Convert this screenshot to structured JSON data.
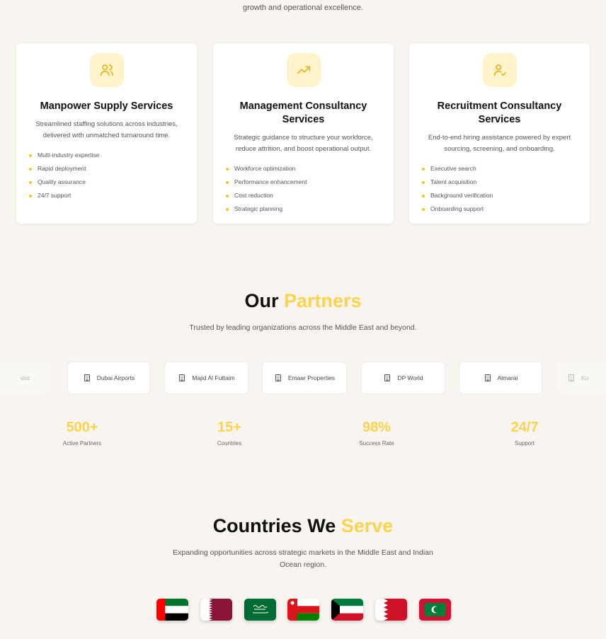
{
  "intro": {
    "line2": "growth and operational excellence."
  },
  "services": [
    {
      "icon": "users-icon",
      "title": "Manpower Supply Services",
      "description": "Streamlined staffing solutions across industries, delivered with unmatched turnaround time.",
      "features": [
        "Multi-industry expertise",
        "Rapid deployment",
        "Quality assurance",
        "24/7 support"
      ]
    },
    {
      "icon": "trending-up-icon",
      "title": "Management Consultancy Services",
      "description": "Strategic guidance to structure your workforce, reduce attrition, and boost operational output.",
      "features": [
        "Workforce optimization",
        "Performance enhancement",
        "Cost reduction",
        "Strategic planning"
      ]
    },
    {
      "icon": "user-check-icon",
      "title": "Recruitment Consultancy Services",
      "description": "End-to-end hiring assistance powered by expert sourcing, screening, and onboarding.",
      "features": [
        "Executive search",
        "Talent acquisition",
        "Background verification",
        "Onboarding support"
      ]
    }
  ],
  "partners_section": {
    "title_main": "Our",
    "title_accent": "Partners",
    "subtitle": "Trusted by leading organizations across the Middle East and beyond.",
    "partners": [
      "Dubai Airports",
      "Majid Al Futtaim",
      "Emaar Properties",
      "DP World",
      "Almarai"
    ],
    "partner_icon": "building-icon",
    "stats": [
      {
        "value": "500+",
        "label": "Active Partners"
      },
      {
        "value": "15+",
        "label": "Countries"
      },
      {
        "value": "98%",
        "label": "Success Rate"
      },
      {
        "value": "24/7",
        "label": "Support"
      }
    ]
  },
  "countries_section": {
    "title_main": "Countries We",
    "title_accent": "Serve",
    "subtitle_line1": "Expanding opportunities across strategic markets in the Middle East and Indian",
    "subtitle_line2": "Ocean region.",
    "flags": [
      "uae-flag",
      "qatar-flag",
      "saudi-arabia-flag",
      "oman-flag",
      "kuwait-flag",
      "bahrain-flag",
      "maldives-flag"
    ]
  },
  "colors": {
    "accent": "#fcd34d",
    "bullet": "#f5c518",
    "icon_bg": "#fff3cc",
    "background": "#f8f5f0"
  }
}
